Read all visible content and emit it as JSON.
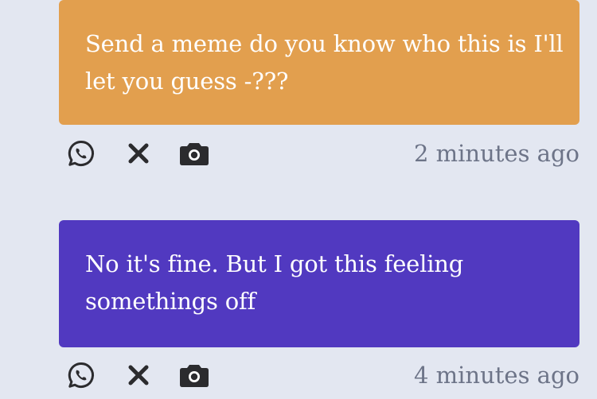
{
  "colors": {
    "background": "#e3e7f1",
    "bubble_1": "#e29f4e",
    "bubble_2": "#5139c0",
    "text_on_bubble": "#ffffff",
    "timestamp": "#6d7488",
    "icon": "#2b2b2e"
  },
  "messages": [
    {
      "text": "Send a meme do you know who this is I'll let you guess -???",
      "timestamp": "2 minutes ago",
      "actions": [
        "whatsapp-icon",
        "close-icon",
        "camera-icon"
      ]
    },
    {
      "text": "No it's fine. But I got this feeling somethings off",
      "timestamp": "4 minutes ago",
      "actions": [
        "whatsapp-icon",
        "close-icon",
        "camera-icon"
      ]
    }
  ]
}
